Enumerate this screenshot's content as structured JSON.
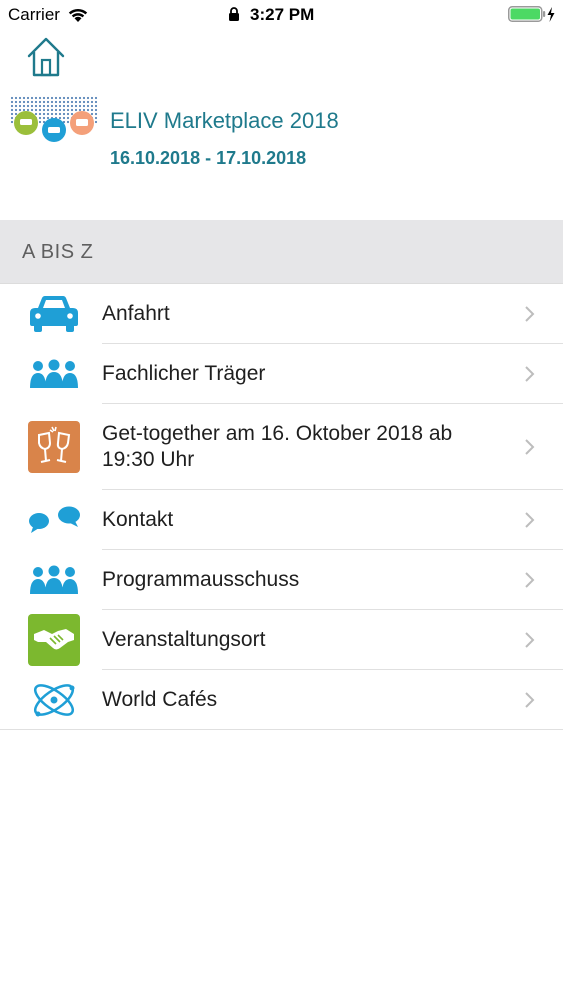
{
  "status_bar": {
    "carrier": "Carrier",
    "time": "3:27 PM",
    "battery_color": "#4cd964"
  },
  "header": {
    "home_icon": "home-icon"
  },
  "event": {
    "title": "ELIV Marketplace 2018",
    "dates": "16.10.2018 - 17.10.2018",
    "accent_color": "#1f7a8c"
  },
  "section": {
    "title": "A BIS Z"
  },
  "list": {
    "items": [
      {
        "label": "Anfahrt",
        "icon": "car-icon"
      },
      {
        "label": "Fachlicher Träger",
        "icon": "people-icon"
      },
      {
        "label": "Get-together am 16. Oktober 2018 ab 19:30 Uhr",
        "icon": "toast-glasses-icon"
      },
      {
        "label": "Kontakt",
        "icon": "chat-bubbles-icon"
      },
      {
        "label": "Programmausschuss",
        "icon": "people-icon"
      },
      {
        "label": "Veranstaltungsort",
        "icon": "handshake-icon"
      },
      {
        "label": "World Cafés",
        "icon": "atom-icon"
      }
    ]
  }
}
